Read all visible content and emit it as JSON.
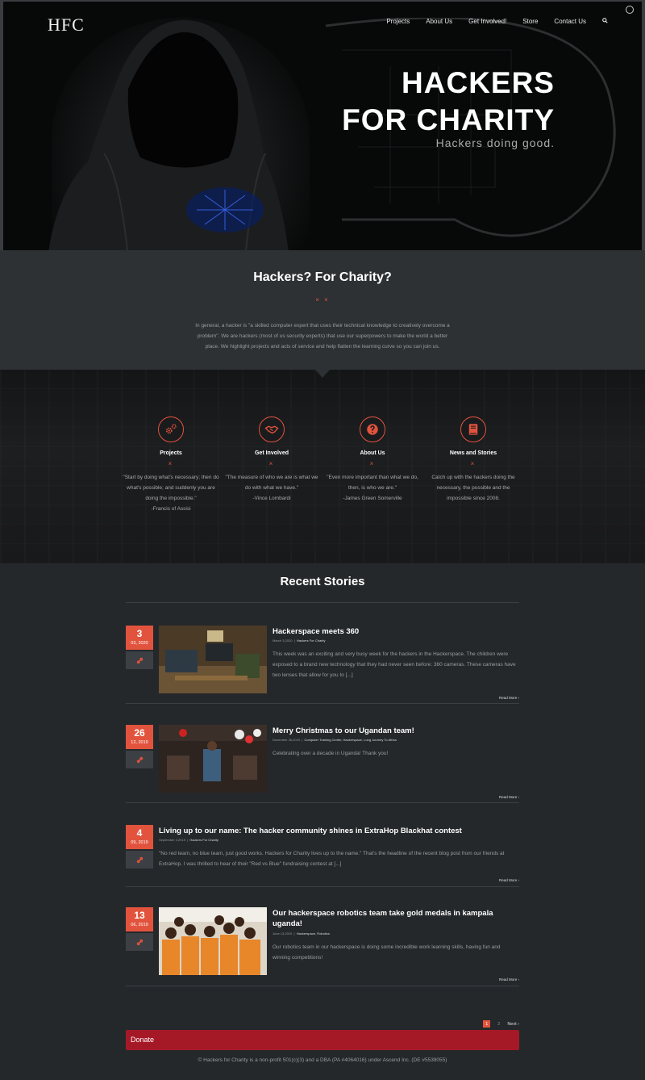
{
  "header": {
    "logo": "HFC",
    "nav": [
      "Projects",
      "About Us",
      "Get Involved!",
      "Store",
      "Contact Us"
    ],
    "search_icon": "search-icon"
  },
  "hero": {
    "title_line1": "HACKERS",
    "title_line2": "FOR CHARITY",
    "subtitle": "Hackers doing good."
  },
  "intro": {
    "heading": "Hackers? For Charity?",
    "separator": "× ×",
    "text": "In general, a hacker is \"a skilled computer expert that uses their technical knowledge to creatively overcome a problem\". We are hackers (most of us security experts) that use our superpowers to make the world a better place. We highlight projects and acts of service and help flatten the learning curve so you can join us."
  },
  "features": [
    {
      "title": "Projects",
      "icon": "gears-icon",
      "quote": "\"Start by doing what's necessary; then do what's possible; and suddenly you are doing the impossible.\"",
      "author": "-Francis of Assisi"
    },
    {
      "title": "Get Involved",
      "icon": "handshake-icon",
      "quote": "\"The measure of who we are is what we do with what we have.\"",
      "author": "-Vince Lombardi"
    },
    {
      "title": "About Us",
      "icon": "question-icon",
      "quote": "\"Even more important than what we do, then, is who we are.\"",
      "author": "-James Green Somerville"
    },
    {
      "title": "News and Stories",
      "icon": "book-icon",
      "quote": "Catch up with the hackers doing the necessary, the possible and the impossible since 2008.",
      "author": ""
    }
  ],
  "feature_separator": "×",
  "stories": {
    "heading": "Recent Stories",
    "read_more": "Read More",
    "items": [
      {
        "day": "3",
        "month": "03, 2020",
        "title": "Hackerspace meets 360",
        "date": "March 3,2020",
        "cats": "Hackers For Charity",
        "excerpt": "This week was an exciting and very busy week for the hackers in the Hackerspace. The children were exposed to a brand new technology that they had never seen before: 360 cameras. These cameras have two lenses that allow for you to [...]"
      },
      {
        "day": "26",
        "month": "12, 2019",
        "title": "Merry Christmas to our Ugandan team!",
        "date": "December 26,2019",
        "cats": "Computer Training Center, Hackerspace, Long Journey To Africa",
        "excerpt": "Celebrating over a decade in Uganda! Thank you!"
      },
      {
        "day": "4",
        "month": "09, 2019",
        "title": "Living up to our name: The hacker community shines in ExtraHop Blackhat contest",
        "date": "September 4,2019",
        "cats": "Hackers For Charity",
        "excerpt": "\"No red team, no blue team, just good works. Hackers for Charity lives up to the name.\" That's the headline of the recent blog post from our friends at ExtraHop. I was thrilled to hear of their  \"Red vs Blue\" fundraising contest at [...]"
      },
      {
        "day": "13",
        "month": "06, 2019",
        "title": "Our hackerspace robotics team take gold medals in kampala uganda!",
        "date": "June 13,2019",
        "cats": "Hackerspace, Robotics",
        "excerpt": "Our robotics team in our hackerspace is doing some incredible work learning skills, having fun and winning competitions!"
      }
    ]
  },
  "pagination": {
    "current": "1",
    "next_page": "2",
    "next": "Next"
  },
  "donate": "Donate",
  "footer": "© Hackers for Charity is a non-profit 501(c)(3) and a DBA (PA #4064016) under Ascend Inc. (DE #5539055)",
  "colors": {
    "accent": "#e2533d",
    "donate": "#a51927",
    "background": "#25282b"
  }
}
